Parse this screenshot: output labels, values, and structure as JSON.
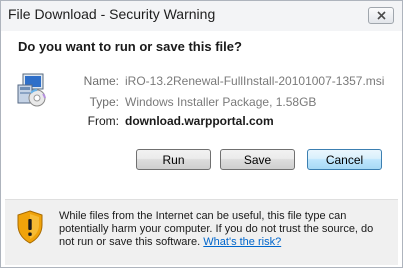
{
  "window": {
    "title": "File Download - Security Warning"
  },
  "dialog": {
    "question": "Do you want to run or save this file?",
    "file": {
      "name_label": "Name:",
      "name_value": "iRO-13.2Renewal-FullInstall-20101007-1357.msi",
      "type_label": "Type:",
      "type_value": "Windows Installer Package, 1.58GB",
      "from_label": "From:",
      "from_value": "download.warpportal.com"
    },
    "buttons": {
      "run": "Run",
      "save": "Save",
      "cancel": "Cancel"
    }
  },
  "footer": {
    "warning_text": "While files from the Internet can be useful, this file type can potentially harm your computer. If you do not trust the source, do not run or save this software.",
    "link_text": "What's the risk?"
  },
  "colors": {
    "link": "#0066cc",
    "shield": "#f0a30a",
    "title_bar": "#f3f4f6"
  }
}
